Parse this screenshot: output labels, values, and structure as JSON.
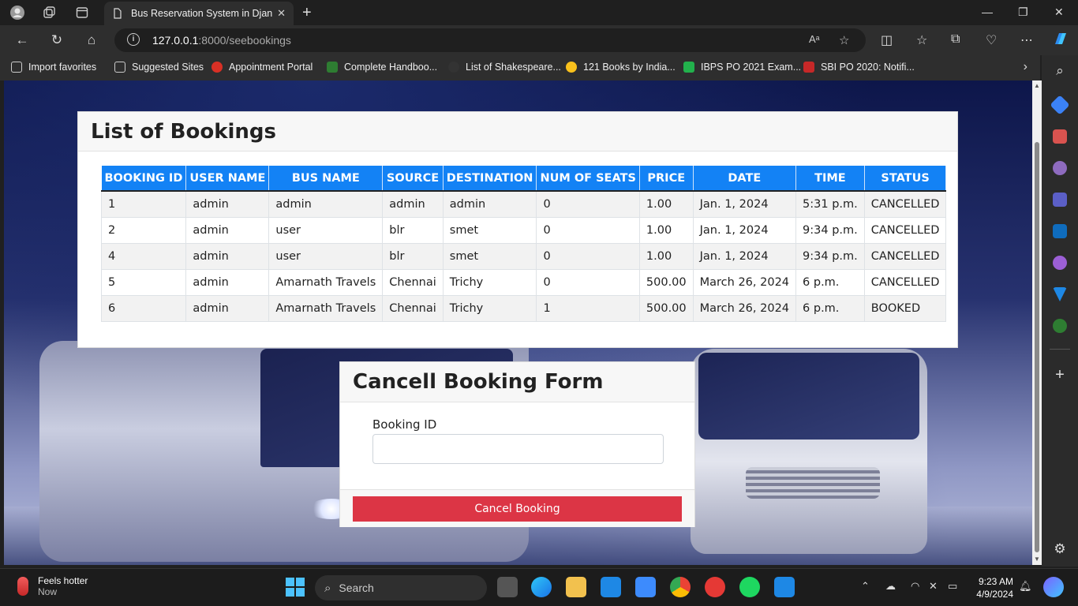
{
  "browser": {
    "tab_title": "Bus Reservation System in Djang",
    "url_host": "127.0.0.1",
    "url_rest": ":8000/seebookings",
    "icons": [
      "profile-icon",
      "workspaces-icon",
      "tab-actions-icon",
      "back-icon",
      "refresh-icon",
      "home-icon",
      "read-aloud-icon",
      "favorite-star-icon",
      "split-screen-icon",
      "favorites-icon",
      "collections-icon",
      "performance-icon",
      "more-icon",
      "copilot-icon"
    ]
  },
  "favorites": [
    {
      "label": "Import favorites"
    },
    {
      "label": "Suggested Sites"
    },
    {
      "label": "Appointment Portal"
    },
    {
      "label": "Complete Handboo..."
    },
    {
      "label": "List of Shakespeare..."
    },
    {
      "label": "121 Books by India..."
    },
    {
      "label": "IBPS PO 2021 Exam..."
    },
    {
      "label": "SBI PO 2020: Notifi..."
    }
  ],
  "bookings": {
    "title": "List of Bookings",
    "columns": [
      "BOOKING ID",
      "USER NAME",
      "BUS NAME",
      "SOURCE",
      "DESTINATION",
      "NUM OF SEATS",
      "PRICE",
      "DATE",
      "TIME",
      "STATUS"
    ],
    "rows": [
      [
        "1",
        "admin",
        "admin",
        "admin",
        "admin",
        "0",
        "1.00",
        "Jan. 1, 2024",
        "5:31 p.m.",
        "CANCELLED"
      ],
      [
        "2",
        "admin",
        "user",
        "blr",
        "smet",
        "0",
        "1.00",
        "Jan. 1, 2024",
        "9:34 p.m.",
        "CANCELLED"
      ],
      [
        "4",
        "admin",
        "user",
        "blr",
        "smet",
        "0",
        "1.00",
        "Jan. 1, 2024",
        "9:34 p.m.",
        "CANCELLED"
      ],
      [
        "5",
        "admin",
        "Amarnath Travels",
        "Chennai",
        "Trichy",
        "0",
        "500.00",
        "March 26, 2024",
        "6 p.m.",
        "CANCELLED"
      ],
      [
        "6",
        "admin",
        "Amarnath Travels",
        "Chennai",
        "Trichy",
        "1",
        "500.00",
        "March 26, 2024",
        "6 p.m.",
        "BOOKED"
      ]
    ]
  },
  "cancel_form": {
    "title": "Cancell Booking Form",
    "field_label": "Booking ID",
    "field_value": "",
    "submit_label": "Cancel Booking"
  },
  "taskbar": {
    "weather_title": "Feels hotter",
    "weather_sub": "Now",
    "search_label": "Search",
    "time": "9:23 AM",
    "date": "4/9/2024"
  },
  "colors": {
    "table_header": "#1382f5",
    "cancel_button": "#dc3545"
  }
}
